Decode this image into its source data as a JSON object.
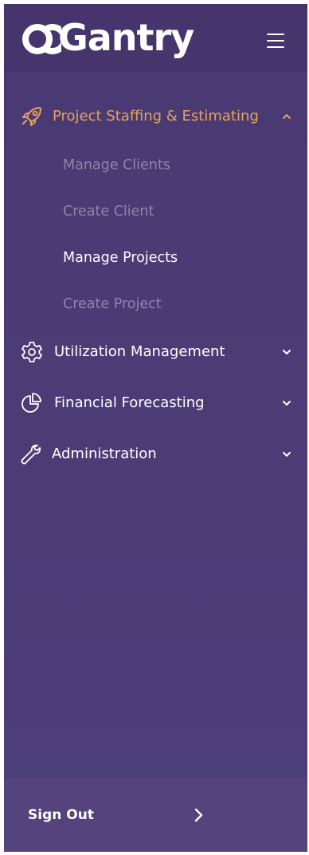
{
  "app": {
    "logo_text": "Gantry"
  },
  "colors": {
    "sidebar_bg": "#4b3c76",
    "active_accent": "#e7a15a",
    "muted_text": "#8e86a8",
    "text": "#ffffff"
  },
  "nav": {
    "sections": [
      {
        "label": "Project Staffing & Estimating",
        "icon": "rocket-icon",
        "expanded": true,
        "items": [
          {
            "label": "Manage Clients"
          },
          {
            "label": "Create Client"
          },
          {
            "label": "Manage Projects",
            "current": true
          },
          {
            "label": "Create Project"
          }
        ]
      },
      {
        "label": "Utilization Management",
        "icon": "gear-icon",
        "expanded": false
      },
      {
        "label": "Financial Forecasting",
        "icon": "pie-chart-icon",
        "expanded": false
      },
      {
        "label": "Administration",
        "icon": "wrench-icon",
        "expanded": false
      }
    ]
  },
  "footer": {
    "sign_out_label": "Sign Out"
  }
}
